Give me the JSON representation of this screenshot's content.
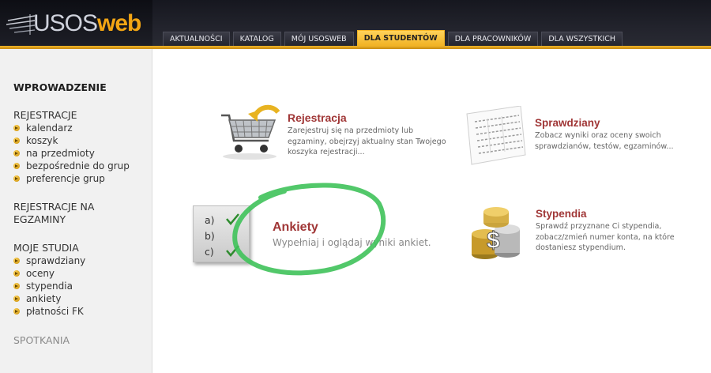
{
  "brand": {
    "part1": "USOS",
    "part2": "web"
  },
  "nav": {
    "tabs": [
      {
        "label": "AKTUALNOŚCI"
      },
      {
        "label": "KATALOG"
      },
      {
        "label": "MÓJ USOSWEB"
      },
      {
        "label": "DLA STUDENTÓW",
        "active": true
      },
      {
        "label": "DLA PRACOWNIKÓW"
      },
      {
        "label": "DLA WSZYSTKICH"
      }
    ]
  },
  "sidebar": {
    "intro": "WPROWADZENIE",
    "registrations": {
      "title": "REJESTRACJE",
      "items": [
        "kalendarz",
        "koszyk",
        "na przedmioty",
        "bezpośrednie do grup",
        "preferencje grup"
      ]
    },
    "exam_registrations": {
      "line1": "REJESTRACJE NA",
      "line2": "EGZAMINY"
    },
    "my_studies": {
      "title": "MOJE STUDIA",
      "items": [
        "sprawdziany",
        "oceny",
        "stypendia",
        "ankiety",
        "płatności FK"
      ]
    },
    "meetings": "SPOTKANIA"
  },
  "tiles": {
    "rejestracja": {
      "title": "Rejestracja",
      "desc1": "Zarejestruj się na przedmioty lub",
      "desc2": "egzaminy, obejrzyj aktualny stan Twojego",
      "desc3": "koszyka rejestracji..."
    },
    "sprawdziany": {
      "title": "Sprawdziany",
      "desc1": "Zobacz wyniki oraz oceny swoich",
      "desc2": "sprawdzianów, testów, egzaminów..."
    },
    "ankiety": {
      "title": "Ankiety",
      "desc": "Wypełniaj i oglądaj wyniki ankiet.",
      "options": [
        "a)",
        "b)",
        "c)"
      ]
    },
    "stypendia": {
      "title": "Stypendia",
      "desc1": "Sprawdź przyznane Ci stypendia,",
      "desc2": "zobacz/zmień numer konta, na które",
      "desc3": "dostaniesz stypendium."
    }
  },
  "colors": {
    "accent": "#f1b224",
    "tile_title": "#a03636",
    "annotation": "#3fc25a"
  }
}
